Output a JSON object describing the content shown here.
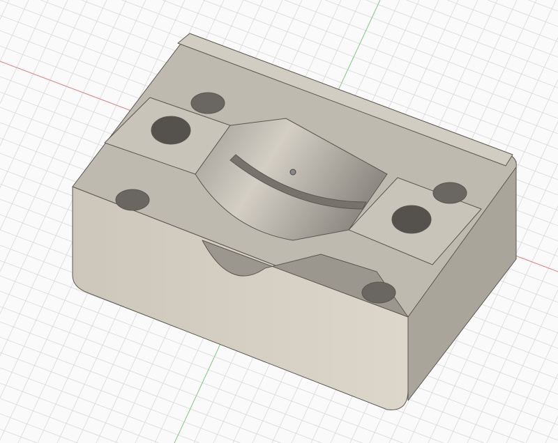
{
  "viewport": {
    "background": "#fafafa",
    "grid_color": "#d9d9d9",
    "x_axis_color": "#e08080",
    "y_axis_color": "#80cc80"
  },
  "model": {
    "top_color": "#bfbab0",
    "front_color": "#d8d2c6",
    "side_color": "#a9a49a",
    "recess_color": "#8f8a82",
    "hole_color": "#55524e"
  }
}
